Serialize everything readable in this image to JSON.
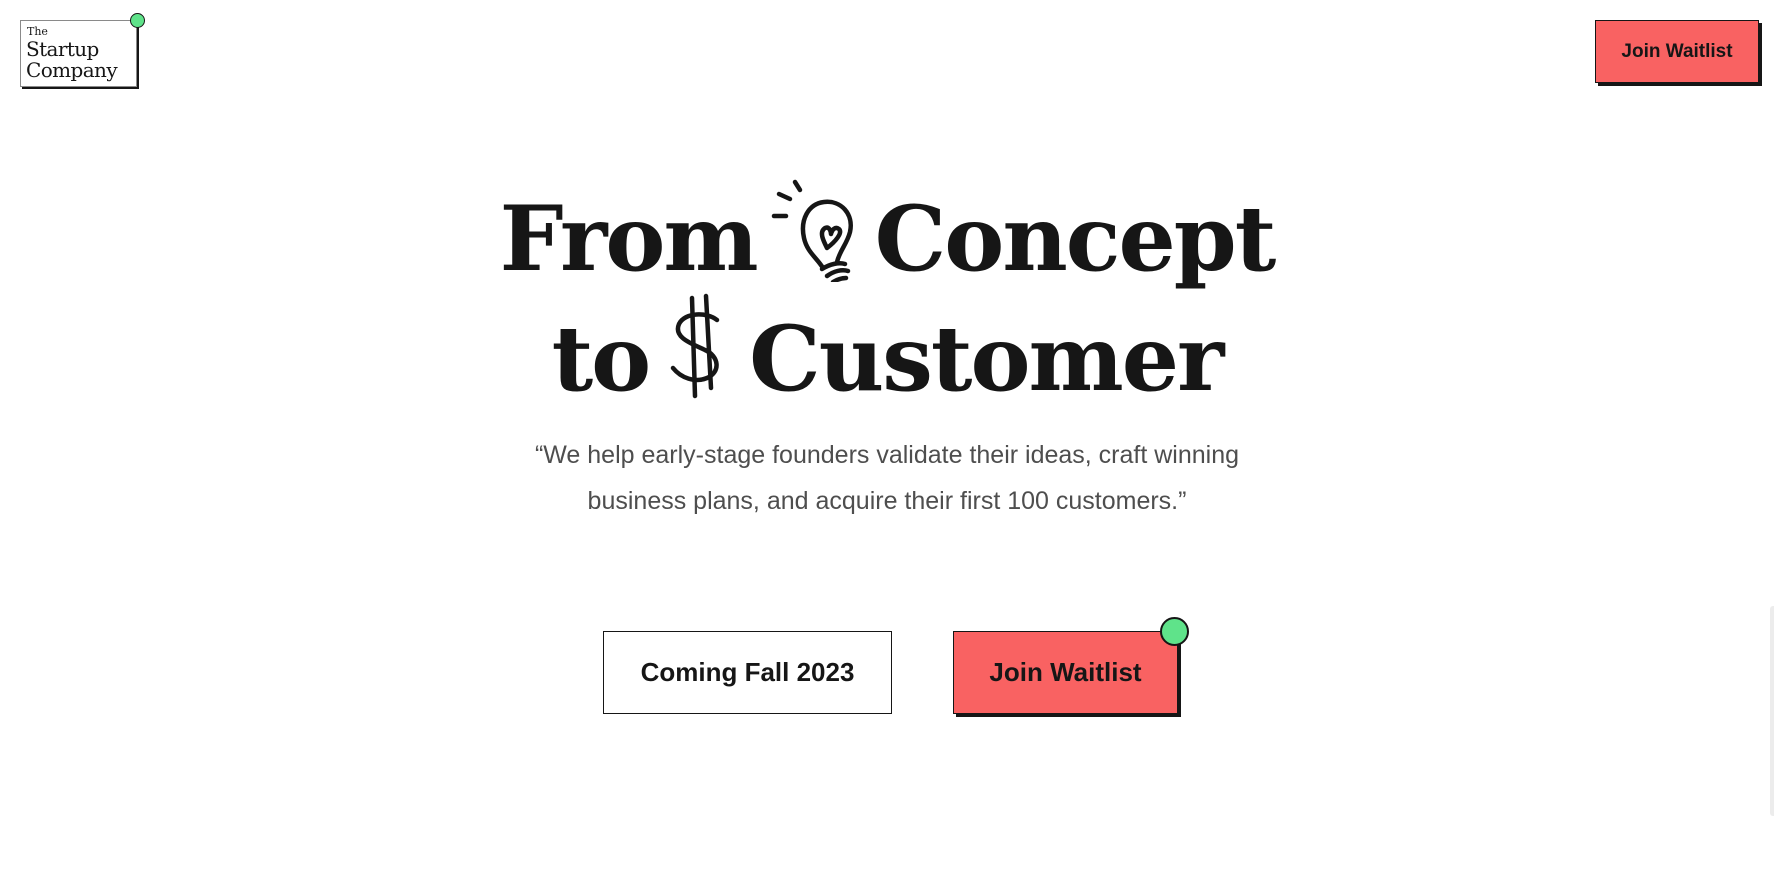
{
  "logo": {
    "line1": "The",
    "line2": "Startup",
    "line3": "Company"
  },
  "header": {
    "cta_label": "Join Waitlist"
  },
  "hero": {
    "line1_start": "From",
    "line1_icon": "lightbulb-icon",
    "line1_end": "Concept",
    "line2_start": "to",
    "line2_icon": "dollar-sign-icon",
    "line2_end": "Customer"
  },
  "tagline": "“We help early-stage founders validate their ideas, craft winning business plans, and acquire their first 100 customers.”",
  "cta": {
    "secondary_label": "Coming Fall 2023",
    "primary_label": "Join Waitlist"
  },
  "colors": {
    "accent": "#f96262",
    "dot": "#5fe38a",
    "text": "#161616",
    "muted_text": "#4e4e4e",
    "background": "#ffffff"
  }
}
